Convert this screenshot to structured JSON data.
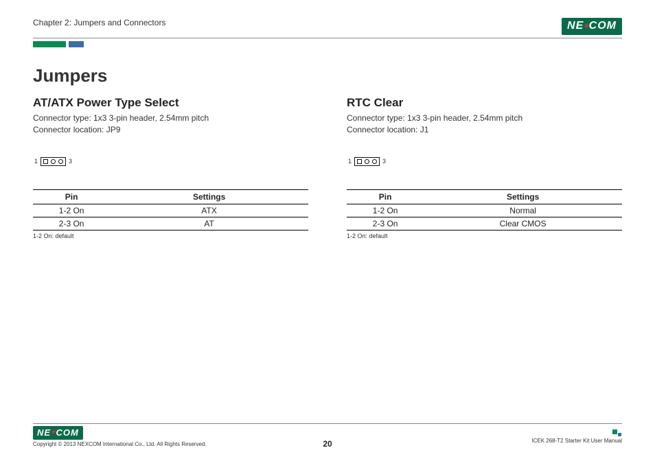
{
  "header": {
    "chapter": "Chapter 2: Jumpers and Connectors",
    "logo_text_pre": "NE",
    "logo_text_post": "COM"
  },
  "page_title": "Jumpers",
  "sections": [
    {
      "title": "AT/ATX Power Type Select",
      "connector_type": "Connector type: 1x3 3-pin header, 2.54mm pitch",
      "connector_location": "Connector location: JP9",
      "pin_left": "1",
      "pin_right": "3",
      "th_pin": "Pin",
      "th_settings": "Settings",
      "rows": [
        {
          "pin": "1-2 On",
          "setting": "ATX"
        },
        {
          "pin": "2-3 On",
          "setting": "AT"
        }
      ],
      "note": "1-2 On: default"
    },
    {
      "title": "RTC Clear",
      "connector_type": "Connector type: 1x3 3-pin header, 2.54mm pitch",
      "connector_location": "Connector location: J1",
      "pin_left": "1",
      "pin_right": "3",
      "th_pin": "Pin",
      "th_settings": "Settings",
      "rows": [
        {
          "pin": "1-2 On",
          "setting": "Normal"
        },
        {
          "pin": "2-3 On",
          "setting": "Clear CMOS"
        }
      ],
      "note": "1-2 On: default"
    }
  ],
  "footer": {
    "copyright": "Copyright © 2013 NEXCOM International Co., Ltd. All Rights Reserved.",
    "page_number": "20",
    "manual": "ICEK 268-T2 Starter Kit User Manual"
  }
}
